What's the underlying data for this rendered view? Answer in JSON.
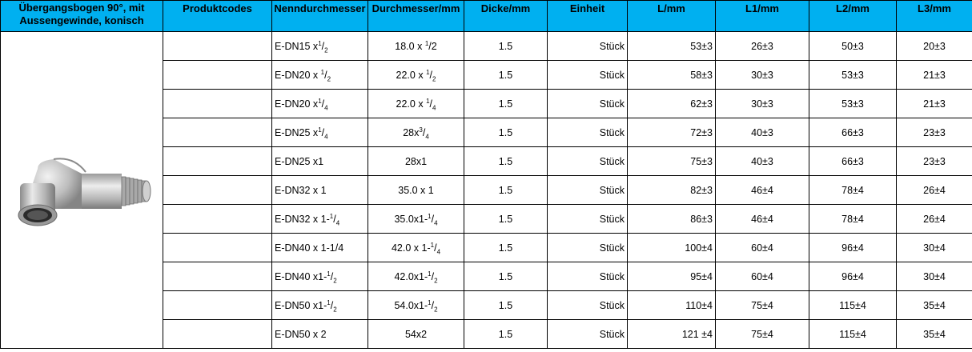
{
  "header": {
    "title": "Übergangsbogen 90°, mit Aussengewinde, konisch",
    "produktcodes": "Produktcodes",
    "nenn": "Nenndurchmesser",
    "durchmesser": "Durchmesser/mm",
    "dicke": "Dicke/mm",
    "einheit": "Einheit",
    "l": "L/mm",
    "l1": "L1/mm",
    "l2": "L2/mm",
    "l3": "L3/mm"
  },
  "product_image": "stainless-steel-90-degree-elbow-with-male-thread",
  "colors": {
    "header_bg": "#00B0F0"
  },
  "rows": [
    {
      "nenn": [
        "E-DN15 x",
        "1",
        "/",
        "2"
      ],
      "durch": [
        "18.0 x ",
        "1",
        "/2",
        ""
      ],
      "dicke": "1.5",
      "einheit": "Stück",
      "l": "53±3",
      "l1": "26±3",
      "l2": "50±3",
      "l3": "20±3"
    },
    {
      "nenn": [
        "E-DN20 x ",
        "1",
        "/",
        "2"
      ],
      "durch": [
        "22.0 x ",
        "1",
        "/",
        "2"
      ],
      "dicke": "1.5",
      "einheit": "Stück",
      "l": "58±3",
      "l1": "30±3",
      "l2": "53±3",
      "l3": "21±3"
    },
    {
      "nenn": [
        "E-DN20 x",
        "1",
        "/",
        "4"
      ],
      "durch": [
        "22.0 x ",
        "1",
        "/",
        "4"
      ],
      "dicke": "1.5",
      "einheit": "Stück",
      "l": "62±3",
      "l1": "30±3",
      "l2": "53±3",
      "l3": "21±3"
    },
    {
      "nenn": [
        "E-DN25 x",
        "1",
        "/",
        "4"
      ],
      "durch": [
        "28x",
        "3",
        "/",
        "4"
      ],
      "dicke": "1.5",
      "einheit": "Stück",
      "l": "72±3",
      "l1": "40±3",
      "l2": "66±3",
      "l3": "23±3"
    },
    {
      "nenn": [
        "E-DN25 x1",
        "",
        "",
        ""
      ],
      "durch": [
        "28x1",
        "",
        "",
        ""
      ],
      "dicke": "1.5",
      "einheit": "Stück",
      "l": "75±3",
      "l1": "40±3",
      "l2": "66±3",
      "l3": "23±3"
    },
    {
      "nenn": [
        "E-DN32 x 1",
        "",
        "",
        ""
      ],
      "durch": [
        "35.0 x 1",
        "",
        "",
        ""
      ],
      "dicke": "1.5",
      "einheit": "Stück",
      "l": "82±3",
      "l1": "46±4",
      "l2": "78±4",
      "l3": "26±4"
    },
    {
      "nenn": [
        "E-DN32 x 1-",
        "1",
        "/",
        "4"
      ],
      "durch": [
        "35.0x1-",
        "1",
        "/",
        "4"
      ],
      "dicke": "1.5",
      "einheit": "Stück",
      "l": "86±3",
      "l1": "46±4",
      "l2": "78±4",
      "l3": "26±4"
    },
    {
      "nenn": [
        "E-DN40 x 1-1/4",
        "",
        "",
        ""
      ],
      "durch": [
        "42.0 x 1-",
        "1",
        "/",
        "4"
      ],
      "dicke": "1.5",
      "einheit": "Stück",
      "l": "100±4",
      "l1": "60±4",
      "l2": "96±4",
      "l3": "30±4"
    },
    {
      "nenn": [
        "E-DN40 x1-",
        "1",
        "/",
        "2"
      ],
      "durch": [
        "42.0x1-",
        "1",
        "/",
        "2"
      ],
      "dicke": "1.5",
      "einheit": "Stück",
      "l": "95±4",
      "l1": "60±4",
      "l2": "96±4",
      "l3": "30±4"
    },
    {
      "nenn": [
        "E-DN50 x1-",
        "1",
        "/",
        "2"
      ],
      "durch": [
        "54.0x1-",
        "1",
        "/",
        "2"
      ],
      "dicke": "1.5",
      "einheit": "Stück",
      "l": "110±4",
      "l1": "75±4",
      "l2": "115±4",
      "l3": "35±4"
    },
    {
      "nenn": [
        "E-DN50 x 2",
        "",
        "",
        ""
      ],
      "durch": [
        "54x2",
        "",
        "",
        ""
      ],
      "dicke": "1.5",
      "einheit": "Stück",
      "l": "121 ±4",
      "l1": "75±4",
      "l2": "115±4",
      "l3": "35±4"
    }
  ]
}
